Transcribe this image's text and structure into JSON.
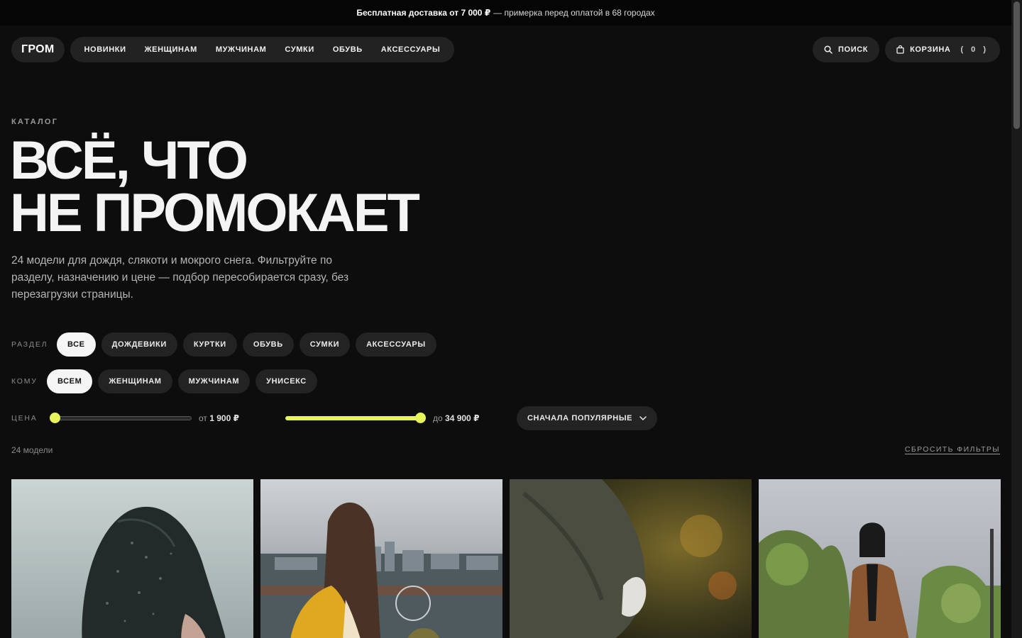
{
  "announcement": {
    "bold": "Бесплатная доставка от 7 000 ₽",
    "rest": "— примерка перед оплатой в 68 городах"
  },
  "header": {
    "logo": "ГРОМ",
    "menu": [
      "НОВИНКИ",
      "ЖЕНЩИНАМ",
      "МУЖЧИНАМ",
      "СУМКИ",
      "ОБУВЬ",
      "АКСЕССУАРЫ"
    ],
    "search_label": "ПОИСК",
    "cart_label": "КОРЗИНА",
    "cart_count": "( 0 )"
  },
  "hero": {
    "eyebrow": "КАТАЛОГ",
    "title_line1": "ВСЁ, ЧТО",
    "title_line2": "НЕ ПРОМОКАЕТ",
    "lead": "24 модели для дождя, слякоти и мокрого снега. Фильтруйте по разделу, назначению и цене — подбор пересобирается сразу, без перезагрузки страницы."
  },
  "filters": {
    "section": {
      "label": "РАЗДЕЛ",
      "options": [
        "ВСЕ",
        "ДОЖДЕВИКИ",
        "КУРТКИ",
        "ОБУВЬ",
        "СУМКИ",
        "АКСЕССУАРЫ"
      ],
      "selected": "ВСЕ"
    },
    "audience": {
      "label": "КОМУ",
      "options": [
        "ВСЕМ",
        "ЖЕНЩИНАМ",
        "МУЖЧИНАМ",
        "УНИСЕКС"
      ],
      "selected": "ВСЕМ"
    },
    "price": {
      "label": "ЦЕНА",
      "min_prefix": "от",
      "min_value": "1 900 ₽",
      "max_prefix": "до",
      "max_value": "34 900 ₽"
    },
    "sort": "СНАЧАЛА ПОПУЛЯРНЫЕ"
  },
  "results": {
    "count": "24 модели",
    "reset": "СБРОСИТЬ ФИЛЬТРЫ"
  },
  "colors": {
    "background": "#0d0d0d",
    "accent": "#e8f55a",
    "chip": "#232323",
    "chip_active": "#f5f5f5"
  },
  "products": [
    {
      "image": "person in black hooded raincoat"
    },
    {
      "image": "girl in yellow raincoat over city view"
    },
    {
      "image": "olive jacket sleeve in autumn"
    },
    {
      "image": "woman in brown coat among trees"
    }
  ]
}
